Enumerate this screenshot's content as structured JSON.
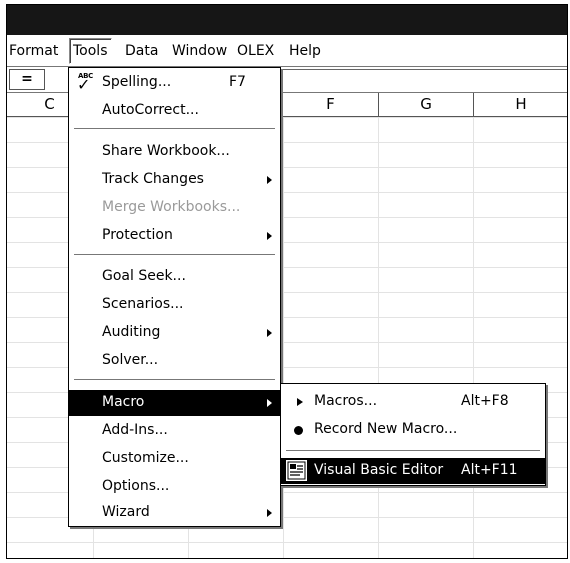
{
  "menubar": {
    "items": [
      {
        "label": "Format"
      },
      {
        "label": "Tools"
      },
      {
        "label": "Data"
      },
      {
        "label": "Window"
      },
      {
        "label": "OLEX"
      },
      {
        "label": "Help"
      }
    ]
  },
  "formula": {
    "eq_label": "="
  },
  "columns": [
    "C",
    "F",
    "G",
    "H"
  ],
  "tools_menu": {
    "items": [
      {
        "label": "Spelling...",
        "shortcut": "F7"
      },
      {
        "label": "AutoCorrect..."
      },
      {
        "label": "Share Workbook..."
      },
      {
        "label": "Track Changes"
      },
      {
        "label": "Merge Workbooks..."
      },
      {
        "label": "Protection"
      },
      {
        "label": "Goal Seek..."
      },
      {
        "label": "Scenarios..."
      },
      {
        "label": "Auditing"
      },
      {
        "label": "Solver..."
      },
      {
        "label": "Macro"
      },
      {
        "label": "Add-Ins..."
      },
      {
        "label": "Customize..."
      },
      {
        "label": "Options..."
      },
      {
        "label": "Wizard"
      }
    ]
  },
  "macro_menu": {
    "items": [
      {
        "label": "Macros...",
        "shortcut": "Alt+F8"
      },
      {
        "label": "Record New Macro..."
      },
      {
        "label": "Visual Basic Editor",
        "shortcut": "Alt+F11"
      }
    ]
  },
  "icons": {
    "spelling": "spelling-check-icon",
    "macros": "play-triangle-icon",
    "record": "record-dot-icon",
    "vbe": "visual-basic-editor-icon"
  }
}
